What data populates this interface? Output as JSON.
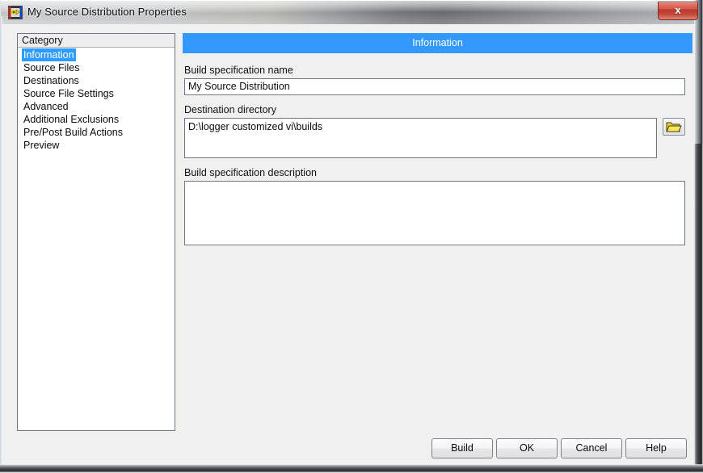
{
  "window": {
    "title": "My Source Distribution Properties",
    "icon": "labview-build-spec-icon",
    "close_label": "x"
  },
  "category": {
    "header": "Category",
    "items": [
      {
        "label": "Information",
        "selected": true
      },
      {
        "label": "Source Files",
        "selected": false
      },
      {
        "label": "Destinations",
        "selected": false
      },
      {
        "label": "Source File Settings",
        "selected": false
      },
      {
        "label": "Advanced",
        "selected": false
      },
      {
        "label": "Additional Exclusions",
        "selected": false
      },
      {
        "label": "Pre/Post Build Actions",
        "selected": false
      },
      {
        "label": "Preview",
        "selected": false
      }
    ]
  },
  "content": {
    "banner": "Information",
    "fields": {
      "build_spec_name": {
        "label": "Build specification name",
        "value": "My Source Distribution"
      },
      "destination_directory": {
        "label": "Destination directory",
        "value": "D:\\logger customized vi\\builds",
        "browse_icon": "folder-open-icon"
      },
      "build_spec_description": {
        "label": "Build specification description",
        "value": ""
      }
    }
  },
  "buttons": {
    "build": "Build",
    "ok": "OK",
    "cancel": "Cancel",
    "help": "Help"
  },
  "colors": {
    "banner_blue": "#3399ff",
    "selection_blue": "#2e9bff",
    "close_red": "#c3483a",
    "dialog_bg": "#f0f0f0"
  }
}
